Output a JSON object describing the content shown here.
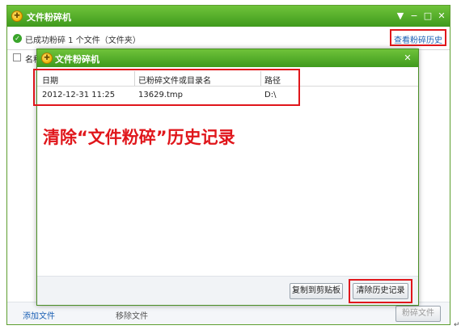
{
  "outer_window": {
    "title": "文件粉碎机",
    "status_text": "已成功粉碎 1 个文件（文件夹）",
    "history_link": "查看粉碎历史",
    "column_name_partial": "名称",
    "controls": {
      "menu": "▼",
      "minimize": "−",
      "maximize": "□",
      "close": "✕"
    },
    "footer": {
      "add_file": "添加文件",
      "remove_file": "移除文件",
      "shred_file": "粉碎文件"
    }
  },
  "dialog": {
    "title": "文件粉碎机",
    "close": "✕",
    "columns": [
      "日期",
      "已粉碎文件或目录名",
      "路径"
    ],
    "rows": [
      {
        "date": "2012-12-31 11:25",
        "name": "13629.tmp",
        "path": "D:\\"
      }
    ],
    "buttons": {
      "copy": "复制到剪贴板",
      "clear": "清除历史记录"
    }
  },
  "annotation": "清除“文件粉碎”历史记录",
  "corner_mark": "↵",
  "colors": {
    "title_green": "#4aa824",
    "highlight_red": "#e0161b",
    "link_blue": "#1a5fb4"
  },
  "icons": [
    "app-logo-icon",
    "success-check-icon",
    "menu-icon",
    "minimize-icon",
    "maximize-icon",
    "close-icon"
  ]
}
